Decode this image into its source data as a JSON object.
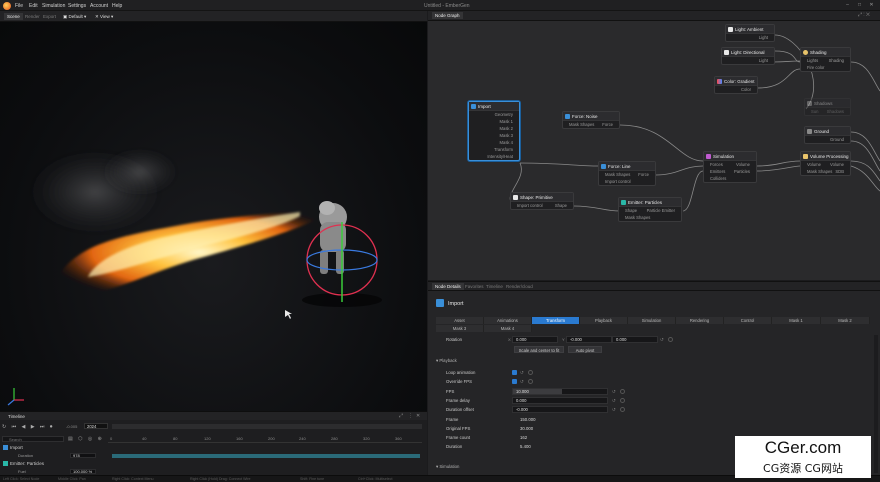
{
  "app": {
    "title": "Untitled - EmberGen",
    "menu": [
      "File",
      "Edit",
      "Simulation",
      "Settings",
      "Account",
      "Help"
    ]
  },
  "viewport": {
    "tabs": [
      "Scene",
      "Render",
      "Export"
    ],
    "camera_label": "Default",
    "view_label": "View"
  },
  "timeline": {
    "title": "Timeline",
    "current_frame": "2024",
    "total_frames": "-0.005",
    "ruler": [
      "0",
      "40",
      "80",
      "120",
      "160",
      "200",
      "240",
      "280",
      "320",
      "360"
    ],
    "tracks": [
      {
        "label": "Import",
        "sub": "Duration",
        "value": "978"
      },
      {
        "label": "Emitter: Particles",
        "sub": "Fuel",
        "value": "100.000 %"
      }
    ],
    "search_placeholder": "Search"
  },
  "statusbar": [
    "Left Click: Select Node",
    "Middle Click: Pan",
    "Right Click: Context Menu",
    "Right Click (Hold) Drag: Connect Wire",
    "Shift: Fine tune",
    "Ctrl+Click: Multiselect"
  ],
  "node_graph": {
    "tab": "Node Graph",
    "nodes": {
      "light_ambient": {
        "title": "Light: Ambient",
        "rows": [
          [
            "",
            "Light"
          ]
        ]
      },
      "light_directional": {
        "title": "Light: Directional",
        "rows": [
          [
            "",
            "Light"
          ]
        ]
      },
      "shading": {
        "title": "Shading",
        "rows": [
          [
            "Lights",
            "Shading"
          ],
          [
            "Fire color",
            ""
          ]
        ]
      },
      "color_gradient": {
        "title": "Color: Gradient",
        "rows": [
          [
            "",
            "Color"
          ]
        ]
      },
      "shadows": {
        "title": "Shadows",
        "rows": [
          [
            "Sun",
            "Shadows"
          ]
        ]
      },
      "ground": {
        "title": "Ground",
        "rows": [
          [
            "",
            "Ground"
          ]
        ]
      },
      "import": {
        "title": "Import",
        "rows": [
          [
            "",
            "Geometry"
          ],
          [
            "",
            "Mask 1"
          ],
          [
            "",
            "Mask 2"
          ],
          [
            "",
            "Mask 3"
          ],
          [
            "",
            "Mask 4"
          ],
          [
            "",
            "Transform"
          ],
          [
            "",
            "Intensity/Heat"
          ]
        ]
      },
      "force_noise": {
        "title": "Force: Noise",
        "rows": [
          [
            "Mask Shapes",
            "Force"
          ]
        ]
      },
      "force_line": {
        "title": "Force: Line",
        "rows": [
          [
            "Mask Shapes",
            "Force"
          ],
          [
            "Import control",
            ""
          ]
        ]
      },
      "simulation": {
        "title": "Simulation",
        "rows": [
          [
            "Forces",
            "Volume"
          ],
          [
            "Emitters",
            "Particles"
          ],
          [
            "Colliders",
            ""
          ]
        ]
      },
      "volume_processing": {
        "title": "Volume Processing",
        "rows": [
          [
            "Volume",
            "Volume"
          ],
          [
            "Mask Shapes",
            "SDB"
          ]
        ]
      },
      "shape_primitive": {
        "title": "Shape: Primitive",
        "rows": [
          [
            "Import control",
            "Shape"
          ]
        ]
      },
      "emitter_particles": {
        "title": "Emitter: Particles",
        "rows": [
          [
            "Shape",
            "Particle Emitter"
          ],
          [
            "Mask Shapes",
            ""
          ]
        ]
      }
    }
  },
  "details": {
    "tabs": [
      "Node Details",
      "Favorites",
      "Timeline",
      "Render/cloud"
    ],
    "node_name": "Import",
    "prop_tabs_row1": [
      "Asset",
      "Animations",
      "Transform",
      "Playback",
      "Simulation",
      "Rendering",
      "Control",
      "Mask 1",
      "Mask 2"
    ],
    "prop_tabs_row2": [
      "Mask 3",
      "Mask 4"
    ],
    "active_tab": "Transform",
    "rotation": {
      "label": "Rotation",
      "x": "0.000",
      "y": "-0.000",
      "z": "0.000"
    },
    "buttons": [
      "Scale and center to fit",
      "Auto pivot"
    ],
    "playback_section": "Playback",
    "simulation_section": "Simulation",
    "props": [
      {
        "label": "Loop animation",
        "type": "check"
      },
      {
        "label": "Override FPS",
        "type": "check"
      },
      {
        "label": "FPS",
        "type": "slider",
        "value": "10.000",
        "fill": 0.52
      },
      {
        "label": "Frame delay",
        "type": "slider",
        "value": "0.000",
        "fill": 0.0
      },
      {
        "label": "Duration offset",
        "type": "slider",
        "value": "-0.000",
        "fill": 0.0
      },
      {
        "label": "Frame",
        "type": "text",
        "value": "150.000"
      },
      {
        "label": "Original FPS",
        "type": "text",
        "value": "30.000"
      },
      {
        "label": "Frame count",
        "type": "text",
        "value": "162"
      },
      {
        "label": "Duration",
        "type": "text",
        "value": "5.400"
      }
    ]
  },
  "watermark": {
    "title": "CGer.com",
    "subtitle": "CG资源 CG网站"
  },
  "colors": {
    "accent": "#2a7ad0",
    "fire": "#ffb33a",
    "panel": "#252527"
  }
}
